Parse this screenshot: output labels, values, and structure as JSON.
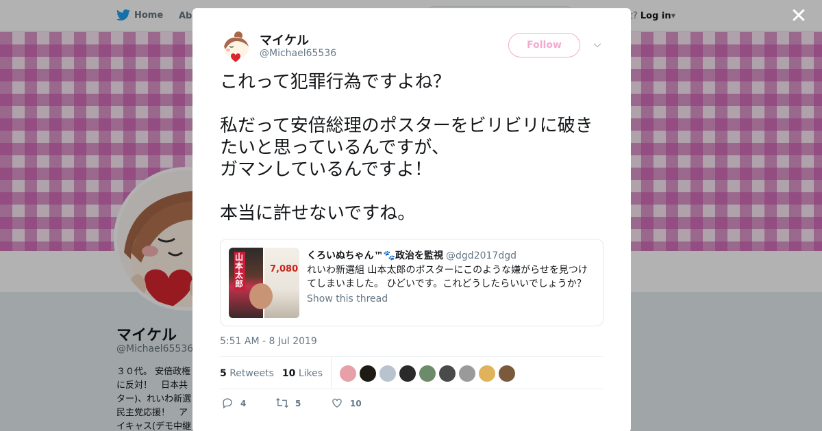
{
  "background": {
    "nav": {
      "home_label": "Home",
      "about_label": "Abo",
      "account_prompt": "ccount?",
      "login_label": "Log in"
    },
    "profile": {
      "name": "マイケル",
      "handle": "@Michael65536",
      "bio": "３０代。 安倍政権 に反対！　日本共 ター)、れいわ新選 民主党応援！　ア イキャス(デモ中継"
    }
  },
  "modal": {
    "close_icon": "close-icon",
    "author": {
      "name": "マイケル",
      "handle": "@Michael65536"
    },
    "follow_label": "Follow",
    "tweet_text": "これって犯罪行為ですよね？\n\n私だって安倍総理のポスターをビリビリに破きたいと思っているんですが、\nガマンしているんですよ！\n\n本当に許せないですね。",
    "quote": {
      "author_name": "くろいぬちゃん™",
      "author_suffix": "政治を監視",
      "author_handle": "@dgd2017dgd",
      "text": "れいわ新選組 山本太郎のポスターにこのような嫌がらせを見つけてしまいました。 ひどいです。これどうしたらいいでしょうか？",
      "show_thread": "Show this thread",
      "poster_label": "山本太郎",
      "poster_number": "7,080"
    },
    "timestamp": "5:51 AM - 8 Jul 2019",
    "stats": {
      "retweets_count": "5",
      "retweets_label": "Retweets",
      "likes_count": "10",
      "likes_label": "Likes"
    },
    "likers": [
      {
        "color": "#e7a0a8"
      },
      {
        "color": "#1e1a14"
      },
      {
        "color": "#b9c3cf"
      },
      {
        "color": "#2a2a2a"
      },
      {
        "color": "#6d8a6a"
      },
      {
        "color": "#4a4a4a"
      },
      {
        "color": "#9a9a9a"
      },
      {
        "color": "#e0b25a"
      },
      {
        "color": "#7a5a3a"
      }
    ],
    "actions": {
      "reply_count": "4",
      "retweet_count": "5",
      "like_count": "10"
    },
    "colors": {
      "follow_pink": "#f4a9d0",
      "banner_pink": "#c850aa"
    }
  }
}
